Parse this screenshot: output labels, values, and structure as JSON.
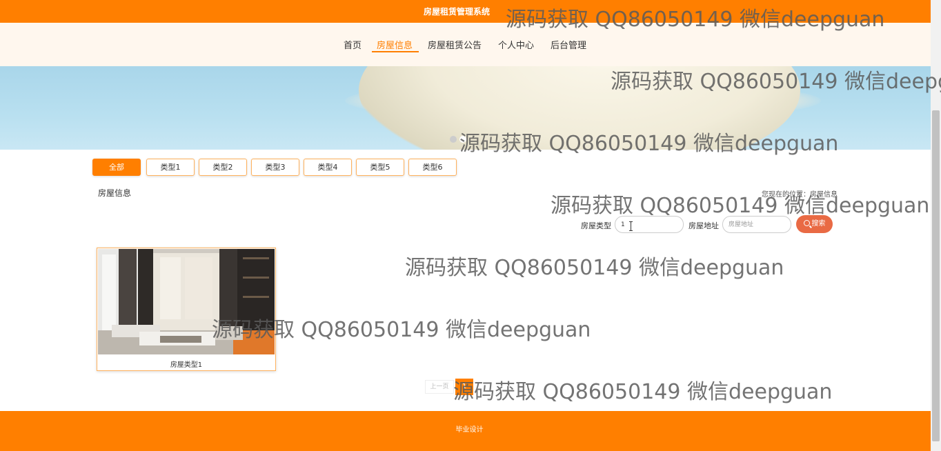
{
  "header": {
    "title": "房屋租赁管理系统"
  },
  "nav": {
    "items": [
      {
        "label": "首页"
      },
      {
        "label": "房屋信息"
      },
      {
        "label": "房屋租赁公告"
      },
      {
        "label": "个人中心"
      },
      {
        "label": "后台管理"
      }
    ],
    "active": "房屋信息"
  },
  "categories": {
    "items": [
      "全部",
      "类型1",
      "类型2",
      "类型3",
      "类型4",
      "类型5",
      "类型6"
    ],
    "active": "全部"
  },
  "section": {
    "title": "房屋信息",
    "breadcrumb": "您现在的位置：房屋信息"
  },
  "search": {
    "type_label": "房屋类型",
    "type_value": "1",
    "address_label": "房屋地址",
    "address_placeholder": "房屋地址",
    "button_label": "搜索"
  },
  "listings": [
    {
      "caption": "房屋类型1"
    }
  ],
  "pagination": {
    "prev_label": "上一页",
    "current": "1"
  },
  "footer": {
    "text": "毕业设计"
  },
  "watermark": {
    "text": "源码获取 QQ86050149 微信deepguan"
  },
  "colors": {
    "primary": "#ff7f00",
    "nav_bg": "#fff7ee",
    "search_button": "#e96a44"
  }
}
